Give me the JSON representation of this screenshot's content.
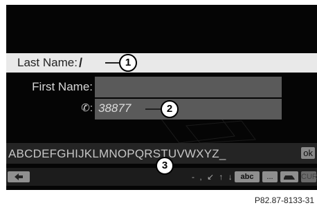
{
  "form": {
    "last_name_label": "Last Name:",
    "last_name_cursor": "/",
    "first_name_label": "First Name:",
    "phone_label": "✆:",
    "phone_value": "38877"
  },
  "keyboard": {
    "letters": [
      "A",
      "B",
      "C",
      "D",
      "E",
      "F",
      "G",
      "H",
      "I",
      "J",
      "K",
      "L",
      "M",
      "N",
      "O",
      "P",
      "Q",
      "R",
      "S",
      "T",
      "U",
      "V",
      "W",
      "X",
      "Y",
      "Z",
      "_"
    ],
    "ok_label": "ok"
  },
  "toolbar": {
    "back_icon": "back-arrow-icon",
    "symbols": "- , ↙ ↑ ↓ →",
    "abc_label": "abc",
    "more_label": "...",
    "nav_icon": "car-icon",
    "cut_label": "CUR"
  },
  "callouts": {
    "one": "1",
    "two": "2",
    "three": "3"
  },
  "figure_ref": "P82.87-8133-31"
}
